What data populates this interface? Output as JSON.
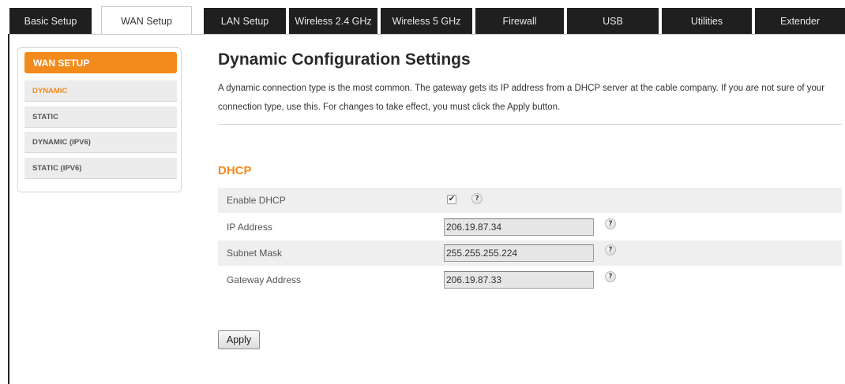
{
  "tabs": [
    {
      "label": "Basic Setup",
      "active": false
    },
    {
      "label": "WAN Setup",
      "active": true
    },
    {
      "label": "LAN Setup",
      "active": false
    },
    {
      "label": "Wireless 2.4 GHz",
      "active": false
    },
    {
      "label": "Wireless 5 GHz",
      "active": false
    },
    {
      "label": "Firewall",
      "active": false
    },
    {
      "label": "USB",
      "active": false
    },
    {
      "label": "Utilities",
      "active": false
    },
    {
      "label": "Extender",
      "active": false
    }
  ],
  "sidebar": {
    "header": "WAN SETUP",
    "items": [
      {
        "label": "DYNAMIC",
        "selected": true
      },
      {
        "label": "STATIC",
        "selected": false
      },
      {
        "label": "DYNAMIC (IPV6)",
        "selected": false
      },
      {
        "label": "STATIC (IPV6)",
        "selected": false
      }
    ]
  },
  "main": {
    "title": "Dynamic Configuration Settings",
    "description": "A dynamic connection type is the most common. The gateway gets its IP address from a DHCP server at the cable company. If you are not sure of your connection type, use this. For changes to take effect, you must click the Apply button.",
    "section_title": "DHCP",
    "fields": {
      "enable_dhcp": {
        "label": "Enable DHCP",
        "checked": true
      },
      "ip_address": {
        "label": "IP Address",
        "value": "206.19.87.34"
      },
      "subnet_mask": {
        "label": "Subnet Mask",
        "value": "255.255.255.224"
      },
      "gateway_address": {
        "label": "Gateway Address",
        "value": "206.19.87.33"
      }
    },
    "help_glyph": "?",
    "check_glyph": "✔",
    "apply_label": "Apply"
  },
  "colors": {
    "accent": "#f28a1c",
    "tab_bg": "#1f1f1f",
    "row_shade": "#efefef"
  },
  "icons": {
    "help": "help-question-icon",
    "checkbox": "checkbox-checked-icon"
  }
}
